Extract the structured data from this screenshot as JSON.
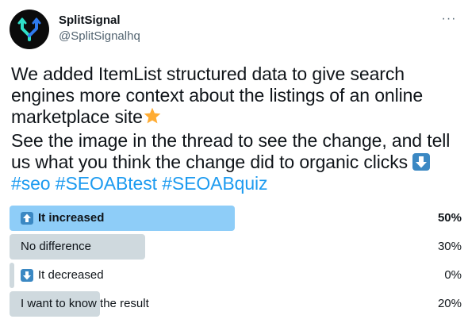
{
  "author": {
    "display_name": "SplitSignal",
    "handle": "@SplitSignalhq",
    "avatar_icon": "splitsignal-logo-icon"
  },
  "more_icon": "more-horizontal-icon",
  "tweet": {
    "line1": "We added ItemList structured data to give search",
    "line2": "engines more context about the listings of an online",
    "line3": "marketplace site",
    "line3_emoji": "star-emoji",
    "line4": "See the image in the thread to see the change, and tell",
    "line5": "us what you think the change did to organic clicks",
    "line5_emoji": "down-arrow-emoji",
    "hashtags": [
      "#seo",
      "#SEOABtest",
      "#SEOABquiz"
    ]
  },
  "poll": {
    "options": [
      {
        "label": "It increased",
        "percent_text": "50%",
        "percent": 50,
        "icon": "up-arrow-emoji",
        "winner": true
      },
      {
        "label": "No difference",
        "percent_text": "30%",
        "percent": 30,
        "icon": null,
        "winner": false
      },
      {
        "label": "It decreased",
        "percent_text": "0%",
        "percent": 0,
        "icon": "down-arrow-emoji",
        "winner": false
      },
      {
        "label": "I want to know the result",
        "percent_text": "20%",
        "percent": 20,
        "icon": null,
        "winner": false
      }
    ]
  },
  "colors": {
    "hashtag": "#1d9bf0",
    "winner_bar": "#8ecdf8",
    "bar": "#cfd9de",
    "emoji_box": "#3b88c3",
    "star": "#ffac33"
  }
}
